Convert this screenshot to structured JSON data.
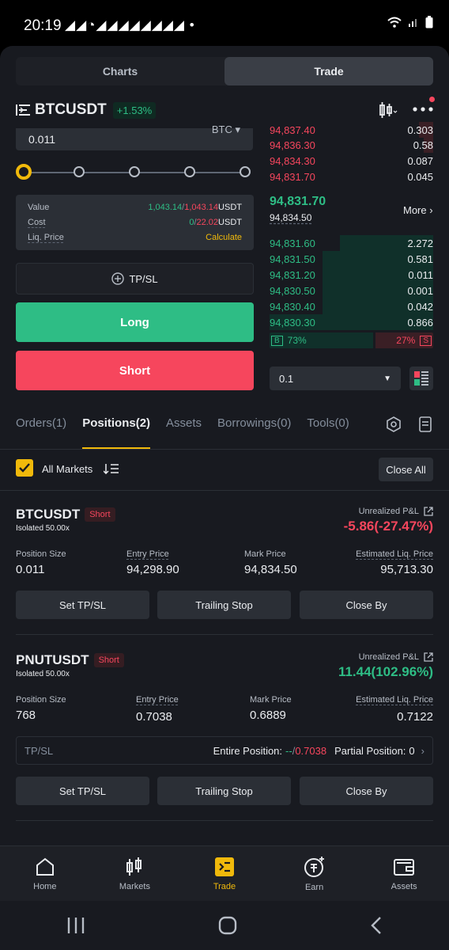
{
  "status_bar": {
    "time": "20:19",
    "notification_icons": "◢◢◔◢◢◢◢◢◢◢◢ •"
  },
  "top_switch": {
    "charts": "Charts",
    "trade": "Trade"
  },
  "pair": {
    "symbol": "BTCUSDT",
    "change": "+1.53%"
  },
  "order_form": {
    "quantity": "0.011",
    "quantity_unit": "BTC",
    "value_label": "Value",
    "value_buy": "1,043.14",
    "value_sell": "1,043.14",
    "value_unit": "USDT",
    "cost_label": "Cost",
    "cost_buy": "0",
    "cost_sell": "22.02",
    "cost_unit": "USDT",
    "liq_label": "Liq. Price",
    "liq_action": "Calculate",
    "tpsl_label": "TP/SL",
    "long_label": "Long",
    "short_label": "Short"
  },
  "orderbook": {
    "asks": [
      {
        "price": "94,837.40",
        "qty": "0.303"
      },
      {
        "price": "94,836.30",
        "qty": "0.58"
      },
      {
        "price": "94,834.30",
        "qty": "0.087"
      },
      {
        "price": "94,831.70",
        "qty": "0.045"
      }
    ],
    "last_price": "94,831.70",
    "mark_price": "94,834.50",
    "more_label": "More",
    "bids": [
      {
        "price": "94,831.60",
        "qty": "2.272"
      },
      {
        "price": "94,831.50",
        "qty": "0.581"
      },
      {
        "price": "94,831.20",
        "qty": "0.011"
      },
      {
        "price": "94,830.50",
        "qty": "0.001"
      },
      {
        "price": "94,830.40",
        "qty": "0.042"
      },
      {
        "price": "94,830.30",
        "qty": "0.866"
      }
    ],
    "buy_badge": "B",
    "buy_ratio": "73%",
    "sell_ratio": "27%",
    "sell_badge": "S",
    "precision": "0.1"
  },
  "tabs": [
    "Orders(1)",
    "Positions(2)",
    "Assets",
    "Borrowings(0)",
    "Tools(0)"
  ],
  "filter": {
    "all_markets": "All Markets",
    "close_all": "Close All"
  },
  "positions": [
    {
      "symbol": "BTCUSDT",
      "side": "Short",
      "margin": "Isolated 50.00x",
      "pnl_label": "Unrealized P&L",
      "pnl": "-5.86(-27.47%)",
      "size_label": "Position Size",
      "size": "0.011",
      "entry_label": "Entry Price",
      "entry": "94,298.90",
      "mark_label": "Mark Price",
      "mark": "94,834.50",
      "liq_label": "Estimated Liq. Price",
      "liq": "95,713.30",
      "btn_tpsl": "Set TP/SL",
      "btn_trailing": "Trailing Stop",
      "btn_close": "Close By"
    },
    {
      "symbol": "PNUTUSDT",
      "side": "Short",
      "margin": "Isolated 50.00x",
      "pnl_label": "Unrealized P&L",
      "pnl": "11.44(102.96%)",
      "size_label": "Position Size",
      "size": "768",
      "entry_label": "Entry Price",
      "entry": "0.7038",
      "mark_label": "Mark Price",
      "mark": "0.6889",
      "liq_label": "Estimated Liq. Price",
      "liq": "0.7122",
      "tpsl_label": "TP/SL",
      "entire_label": "Entire Position:",
      "entire_tp": "--",
      "entire_sl": "0.7038",
      "partial_label": "Partial Position:",
      "partial_value": "0",
      "btn_tpsl": "Set TP/SL",
      "btn_trailing": "Trailing Stop",
      "btn_close": "Close By"
    }
  ],
  "bottom_nav": [
    "Home",
    "Markets",
    "Trade",
    "Earn",
    "Assets"
  ],
  "colors": {
    "green": "#2ebd85",
    "red": "#f6465d",
    "accent": "#f0b90b",
    "bg": "#181a20"
  }
}
